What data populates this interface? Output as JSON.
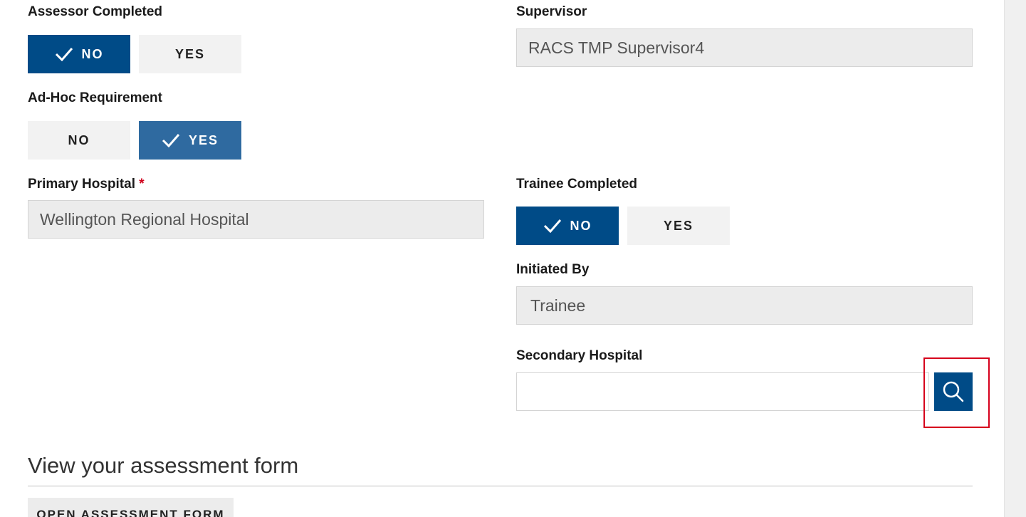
{
  "assessor_completed": {
    "label": "Assessor Completed",
    "no_label": "NO",
    "yes_label": "YES",
    "selected": "NO"
  },
  "supervisor": {
    "label": "Supervisor",
    "value": "RACS TMP Supervisor4"
  },
  "adhoc_requirement": {
    "label": "Ad-Hoc Requirement",
    "no_label": "NO",
    "yes_label": "YES",
    "selected": "YES"
  },
  "primary_hospital": {
    "label": "Primary Hospital",
    "required_marker": "*",
    "value": "Wellington Regional Hospital"
  },
  "trainee_completed": {
    "label": "Trainee Completed",
    "no_label": "NO",
    "yes_label": "YES",
    "selected": "NO"
  },
  "initiated_by": {
    "label": "Initiated By",
    "value": "Trainee"
  },
  "secondary_hospital": {
    "label": "Secondary Hospital",
    "value": "",
    "search_icon": "search-icon"
  },
  "assessment_section": {
    "heading": "View your assessment form",
    "open_button_label": "OPEN ASSESSMENT FORM"
  },
  "colors": {
    "primary": "#004b87",
    "primary_light": "#2f6aa0",
    "highlight": "#d6001c",
    "required": "#d0021b"
  }
}
